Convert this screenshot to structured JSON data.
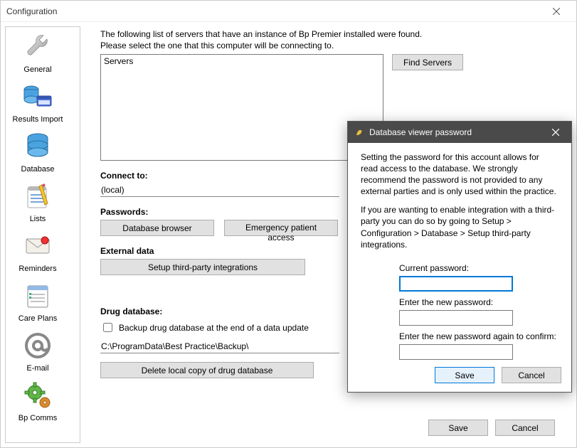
{
  "window": {
    "title": "Configuration"
  },
  "sidebar": {
    "items": [
      {
        "label": "General"
      },
      {
        "label": "Results Import"
      },
      {
        "label": "Database"
      },
      {
        "label": "Lists"
      },
      {
        "label": "Reminders"
      },
      {
        "label": "Care Plans"
      },
      {
        "label": "E-mail"
      },
      {
        "label": "Bp Comms"
      }
    ]
  },
  "main": {
    "intro1": "The following list of servers that have an instance of Bp Premier installed were found.",
    "intro2": "Please select the one that this computer will be connecting to.",
    "servers_header": "Servers",
    "find_servers": "Find Servers",
    "connect_to_label": "Connect to:",
    "connect_to_value": "(local)",
    "passwords_label": "Passwords:",
    "db_browser_btn": "Database browser",
    "emergency_btn": "Emergency patient access",
    "external_label": "External data",
    "third_party_btn": "Setup third-party integrations",
    "drug_db_label": "Drug database:",
    "backup_chk_label": "Backup drug database at the end of a data update",
    "backup_path": "C:\\ProgramData\\Best Practice\\Backup\\",
    "delete_btn": "Delete local copy of drug database",
    "save": "Save",
    "cancel": "Cancel"
  },
  "dialog": {
    "title": "Database viewer password",
    "para1": "Setting the password for this account allows for read access to the database. We strongly recommend the password is not provided to any external parties and is only used within the practice.",
    "para2": "If you are wanting to enable integration with a third-party you can do so by going to Setup > Configuration > Database > Setup third-party integrations.",
    "current_label": "Current password:",
    "new_label": "Enter the new password:",
    "confirm_label": "Enter the new password again to confirm:",
    "save": "Save",
    "cancel": "Cancel"
  }
}
